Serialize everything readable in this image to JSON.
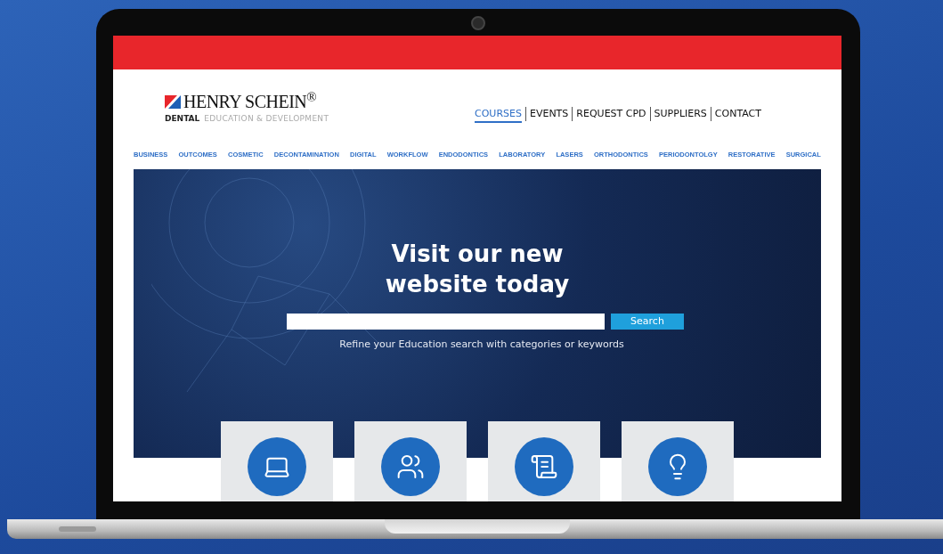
{
  "brand": {
    "name": "HENRY SCHEIN$^{®}$",
    "division": "DENTAL",
    "tagline": "EDUCATION & DEVELOPMENT"
  },
  "top_nav": [
    {
      "label": "COURSES",
      "selected": true
    },
    {
      "label": "EVENTS",
      "selected": false
    },
    {
      "label": "REQUEST CPD",
      "selected": false
    },
    {
      "label": "SUPPLIERS",
      "selected": false
    },
    {
      "label": "CONTACT",
      "selected": false
    }
  ],
  "categories": [
    "BUSINESS",
    "OUTCOMES",
    "COSMETIC",
    "DECONTAMINATION",
    "DIGITAL",
    "WORKFLOW",
    "ENDODONTICS",
    "LABORATORY",
    "LASERS",
    "ORTHODONTICS",
    "PERIODONTOLGY",
    "RESTORATIVE",
    "SURGICAL"
  ],
  "hero": {
    "title_lines": [
      "Visit our new",
      "website today"
    ],
    "search_button": "Search",
    "hint": "Refine your Education search with categories or keywords"
  }
}
